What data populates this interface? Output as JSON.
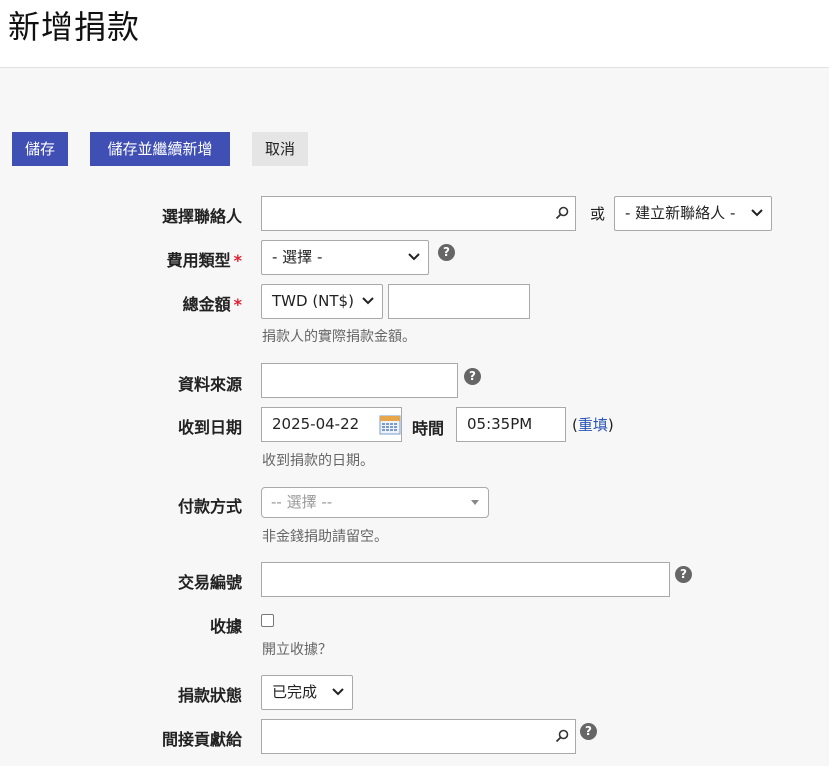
{
  "page": {
    "title": "新增捐款"
  },
  "buttons": {
    "save": "儲存",
    "save_new": "儲存並繼續新增",
    "cancel": "取消"
  },
  "form": {
    "contact": {
      "label": "選擇聯絡人",
      "value": "",
      "or_text": "或",
      "new_contact": "- 建立新聯絡人 -"
    },
    "financial_type": {
      "label": "費用類型",
      "required_mark": "*",
      "value": "- 選擇 -"
    },
    "total_amount": {
      "label": "總金額",
      "required_mark": "*",
      "currency": "TWD (NT$)",
      "value": "",
      "hint": "捐款人的實際捐款金額。"
    },
    "source": {
      "label": "資料來源",
      "value": ""
    },
    "receive_date": {
      "label": "收到日期",
      "date": "2025-04-22",
      "time_label": "時間",
      "time": "05:35PM",
      "paren_open": "(",
      "reset_link": "重填",
      "paren_close": ")",
      "hint": "收到捐款的日期。"
    },
    "payment_method": {
      "label": "付款方式",
      "placeholder": "-- 選擇 --",
      "hint": "非金錢捐助請留空。"
    },
    "trxn_id": {
      "label": "交易編號",
      "value": ""
    },
    "receipt": {
      "label": "收據",
      "checked": false,
      "hint": "開立收據？"
    },
    "status": {
      "label": "捐款狀態",
      "value": "已完成"
    },
    "soft_credit": {
      "label": "間接貢獻給",
      "value": ""
    }
  },
  "icons": {
    "help": "?",
    "search": "search-icon",
    "calendar": "calendar-icon",
    "chevron": "chevron-down-icon"
  },
  "colors": {
    "primary_button": "#3f4fb4",
    "required": "#dd2233",
    "link": "#2b56b7"
  }
}
